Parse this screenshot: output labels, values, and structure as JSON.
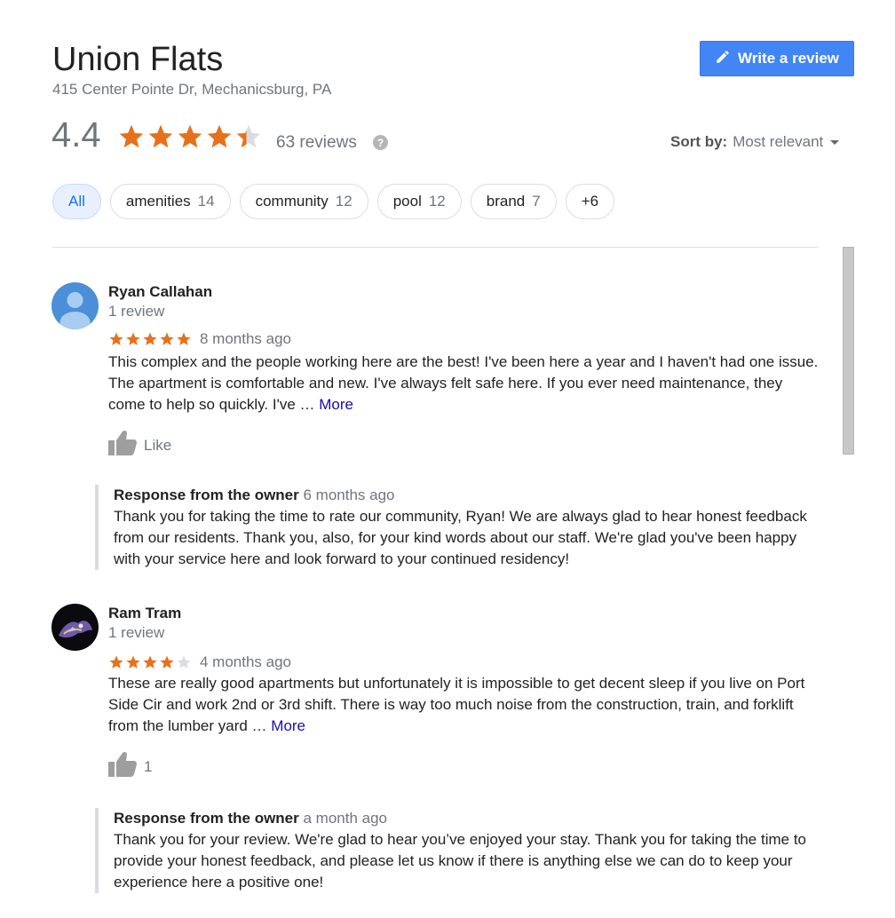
{
  "place": {
    "name": "Union Flats",
    "address": "415 Center Pointe Dr, Mechanicsburg, PA",
    "rating": "4.4",
    "rating_value": 4.4,
    "review_count": "63 reviews",
    "help_icon": "?"
  },
  "actions": {
    "write_review_label": "Write a review",
    "write_review_icon": "pencil-icon"
  },
  "sort": {
    "label": "Sort by:",
    "value": "Most relevant"
  },
  "chips": [
    {
      "label": "All",
      "count": "",
      "active": true
    },
    {
      "label": "amenities",
      "count": "14"
    },
    {
      "label": "community",
      "count": "12"
    },
    {
      "label": "pool",
      "count": "12"
    },
    {
      "label": "brand",
      "count": "7"
    },
    {
      "label": "+6",
      "count": ""
    }
  ],
  "colors": {
    "star": "#e7711b",
    "star_empty": "#dadce0",
    "accent": "#4285f4",
    "link": "#1a0dab"
  },
  "reviews": [
    {
      "name": "Ryan Callahan",
      "meta": "1 review",
      "stars": 5,
      "time": "8 months ago",
      "text": "This complex and the people working here are the best! I've been here a year and I haven't had one issue. The apartment is comfortable and new. I've always felt safe here. If you ever need maintenance, they come to help so quickly. I've … ",
      "more": "More",
      "like": "Like",
      "owner_label": "Response from the owner",
      "owner_time": "6 months ago",
      "owner_text": "Thank you for taking the time to rate our community, Ryan! We are always glad to hear honest feedback from our residents. Thank you, also, for your kind words about our staff. We're glad you've been happy with your service here and look forward to your continued residency!"
    },
    {
      "name": "Ram Tram",
      "meta": "1 review",
      "stars": 4,
      "time": "4 months ago",
      "text": "These are really good apartments but unfortunately it is impossible to get decent sleep if you live on Port Side Cir and work 2nd or 3rd shift. There is way too much noise from the construction, train, and forklift from the lumber yard … ",
      "more": "More",
      "like": "1",
      "owner_label": "Response from the owner",
      "owner_time": "a month ago",
      "owner_text": "Thank you for your review. We're glad to hear you’ve enjoyed your stay. Thank you for taking the time to provide your honest feedback, and please let us know if there is anything else we can do to keep your experience here a positive one!"
    }
  ]
}
